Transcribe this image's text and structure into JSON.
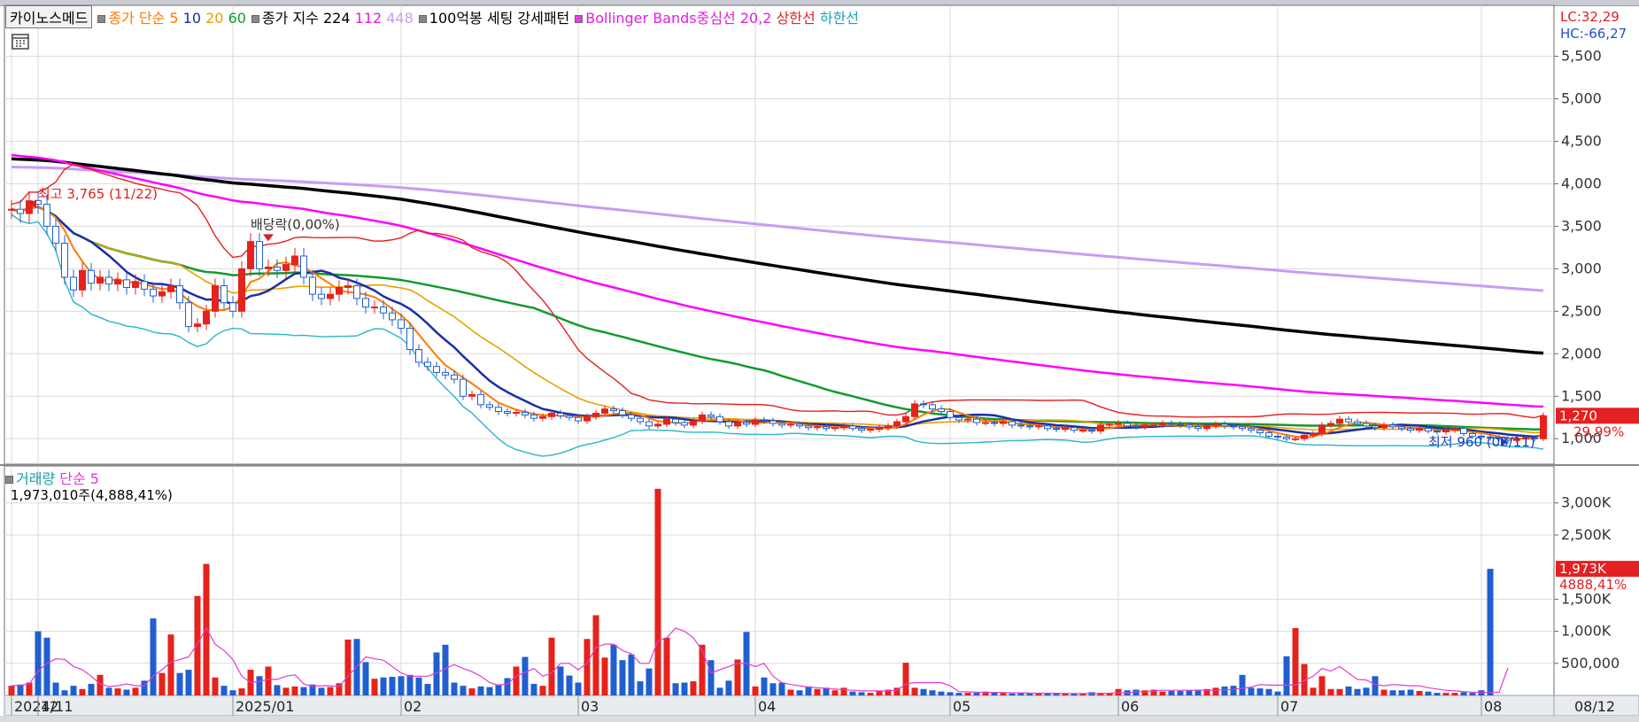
{
  "legend": {
    "title": "카이노스메드",
    "sma_label": "종가 단순 5",
    "sma10": "10",
    "sma20": "20",
    "sma60": "60",
    "idx_label": "종가 지수 224",
    "idx112": "112",
    "idx448": "448",
    "pattern": "100억봉 세팅 강세패턴",
    "bb_label": "Bollinger Bands중심선 20,2",
    "bb_upper": "상한선",
    "bb_lower": "하한선"
  },
  "readouts": {
    "lc": "LC:32,29",
    "hc": "HC:-66,27"
  },
  "volume_panel": {
    "label": "거래량",
    "sma": "단순 5",
    "info": "1,973,010주(4,888,41%)"
  },
  "colors": {
    "up": "#e5221b",
    "down": "#1f5fd0",
    "sma5": "#ff7a00",
    "sma10": "#1a2ea8",
    "sma20": "#e8a000",
    "sma60": "#139a2c",
    "ema224": "#000000",
    "ema112": "#ff00ff",
    "ema448": "#c79cf2",
    "bb_upper": "#e52020",
    "bb_lower": "#29b6c8",
    "vol_sma": "#e03cd0"
  },
  "chart_data": [
    {
      "type": "candlestick",
      "title": "카이노스메드",
      "y_ticks": [
        {
          "v": 5500,
          "label": "5,500"
        },
        {
          "v": 5000,
          "label": "5,000"
        },
        {
          "v": 4500,
          "label": "4,500"
        },
        {
          "v": 4000,
          "label": "4,000"
        },
        {
          "v": 3500,
          "label": "3,500"
        },
        {
          "v": 3000,
          "label": "3,000"
        },
        {
          "v": 2500,
          "label": "2,500"
        },
        {
          "v": 2000,
          "label": "2,000"
        },
        {
          "v": 1500,
          "label": "1,500"
        },
        {
          "v": 1000,
          "label": "1,000"
        }
      ],
      "ylim": [
        700,
        6100
      ],
      "x_ticks": [
        {
          "i": 0,
          "label": "2024/11"
        },
        {
          "i": 3,
          "label": "12"
        },
        {
          "i": 25,
          "label": "2025/01"
        },
        {
          "i": 44,
          "label": "02"
        },
        {
          "i": 64,
          "label": "03"
        },
        {
          "i": 84,
          "label": "04"
        },
        {
          "i": 106,
          "label": "05"
        },
        {
          "i": 125,
          "label": "06"
        },
        {
          "i": 143,
          "label": "07"
        },
        {
          "i": 166,
          "label": "08"
        },
        {
          "i": 179,
          "label": "08/12"
        }
      ],
      "n_bars": 174,
      "closes": [
        3700,
        3650,
        3800,
        3760,
        3500,
        3300,
        2900,
        2750,
        2980,
        2830,
        2900,
        2820,
        2870,
        2780,
        2850,
        2760,
        2680,
        2730,
        2800,
        2600,
        2320,
        2350,
        2500,
        2800,
        2600,
        2500,
        3000,
        3320,
        3000,
        3020,
        2980,
        3050,
        3150,
        2900,
        2700,
        2650,
        2700,
        2780,
        2800,
        2650,
        2550,
        2550,
        2480,
        2400,
        2300,
        2050,
        1900,
        1850,
        1780,
        1750,
        1700,
        1500,
        1520,
        1400,
        1370,
        1320,
        1300,
        1310,
        1280,
        1240,
        1260,
        1300,
        1270,
        1250,
        1210,
        1260,
        1300,
        1350,
        1330,
        1280,
        1240,
        1200,
        1150,
        1170,
        1230,
        1190,
        1160,
        1210,
        1280,
        1260,
        1200,
        1150,
        1190,
        1170,
        1220,
        1210,
        1180,
        1160,
        1170,
        1150,
        1130,
        1140,
        1120,
        1130,
        1150,
        1120,
        1100,
        1110,
        1130,
        1150,
        1200,
        1260,
        1410,
        1400,
        1350,
        1320,
        1250,
        1220,
        1230,
        1190,
        1190,
        1180,
        1200,
        1160,
        1150,
        1140,
        1150,
        1120,
        1110,
        1130,
        1100,
        1100,
        1090,
        1160,
        1170,
        1180,
        1150,
        1140,
        1160,
        1160,
        1180,
        1170,
        1160,
        1140,
        1120,
        1150,
        1170,
        1150,
        1140,
        1120,
        1100,
        1070,
        1030,
        1020,
        1000,
        1000,
        1040,
        1060,
        1160,
        1180,
        1230,
        1200,
        1180,
        1150,
        1130,
        1160,
        1140,
        1120,
        1100,
        1120,
        1090,
        1080,
        1100,
        1120,
        1060,
        1030,
        1020,
        1010,
        1000,
        980,
        1000,
        1010,
        1000,
        1270
      ],
      "annotations": [
        {
          "text": "최고 3,765 (11/22)",
          "color": "#e02020"
        },
        {
          "text": "배당락(0,00%)",
          "color": "#333333"
        },
        {
          "text": "최저 960 (08/11)",
          "color": "#2040c0"
        }
      ],
      "last_price": {
        "label": "1,270",
        "pct": "29,99%"
      }
    },
    {
      "type": "bar",
      "title": "거래량",
      "y_ticks": [
        {
          "v": 3000,
          "label": "3,000K"
        },
        {
          "v": 2500,
          "label": "2,500K"
        },
        {
          "v": 1500,
          "label": "1,500K"
        },
        {
          "v": 1000,
          "label": "1,000K"
        },
        {
          "v": 500,
          "label": "500,000"
        }
      ],
      "ylim": [
        0,
        3300
      ],
      "unit": "K",
      "values": [
        150,
        170,
        200,
        1000,
        900,
        200,
        80,
        150,
        100,
        180,
        320,
        120,
        110,
        90,
        120,
        230,
        1200,
        350,
        950,
        350,
        400,
        1550,
        2050,
        280,
        150,
        80,
        110,
        400,
        300,
        450,
        160,
        120,
        140,
        130,
        170,
        120,
        130,
        190,
        870,
        880,
        520,
        260,
        280,
        290,
        300,
        320,
        280,
        180,
        670,
        790,
        200,
        150,
        110,
        140,
        130,
        170,
        270,
        450,
        600,
        180,
        150,
        900,
        450,
        310,
        200,
        880,
        1250,
        590,
        790,
        550,
        640,
        220,
        420,
        3220,
        900,
        190,
        200,
        220,
        790,
        550,
        120,
        230,
        560,
        990,
        140,
        280,
        190,
        200,
        90,
        80,
        140,
        100,
        120,
        80,
        120,
        60,
        50,
        40,
        70,
        90,
        120,
        510,
        120,
        100,
        80,
        60,
        50,
        40,
        40,
        40,
        60,
        50,
        40,
        30,
        40,
        40,
        30,
        30,
        40,
        30,
        30,
        30,
        50,
        40,
        40,
        100,
        80,
        90,
        80,
        90,
        60,
        70,
        70,
        80,
        90,
        100,
        120,
        140,
        150,
        320,
        120,
        110,
        100,
        60,
        610,
        1050,
        490,
        120,
        300,
        100,
        100,
        140,
        100,
        120,
        300,
        90,
        80,
        80,
        90,
        70,
        60,
        40,
        40,
        40,
        50,
        40,
        80,
        1973
      ],
      "vol_sma5": [
        150,
        160,
        175,
        380,
        500,
        570,
        560,
        450,
        400,
        300,
        180,
        140,
        150,
        180,
        150,
        150,
        300,
        400,
        520,
        560,
        600,
        800,
        1050,
        800,
        700,
        560,
        300,
        200,
        220,
        250,
        250,
        300,
        320,
        180,
        140,
        150,
        150,
        140,
        300,
        450,
        600,
        570,
        550,
        450,
        350,
        300,
        300,
        300,
        350,
        420,
        480,
        420,
        370,
        300,
        200,
        160,
        180,
        300,
        360,
        420,
        300,
        350,
        500,
        500,
        400,
        500,
        750,
        800,
        800,
        700,
        650,
        500,
        500,
        850,
        900,
        1050,
        1000,
        900,
        700,
        350,
        400,
        450,
        500,
        500,
        450,
        500,
        300,
        200,
        170,
        150,
        130,
        120,
        110,
        100,
        90,
        80,
        70,
        70,
        70,
        70,
        80,
        180,
        200,
        200,
        200,
        200,
        150,
        60,
        55,
        50,
        48,
        47,
        45,
        40,
        40,
        36,
        35,
        34,
        33,
        32,
        31,
        30,
        30,
        30,
        35,
        40,
        40,
        55,
        60,
        70,
        80,
        80,
        80,
        80,
        80,
        80,
        80,
        85,
        95,
        110,
        130,
        170,
        160,
        160,
        160,
        160,
        230,
        300,
        420,
        380,
        450,
        350,
        250,
        240,
        170,
        150,
        170,
        160,
        150,
        150,
        120,
        100,
        80,
        70,
        60,
        50,
        45,
        45,
        50,
        430
      ]
    }
  ]
}
